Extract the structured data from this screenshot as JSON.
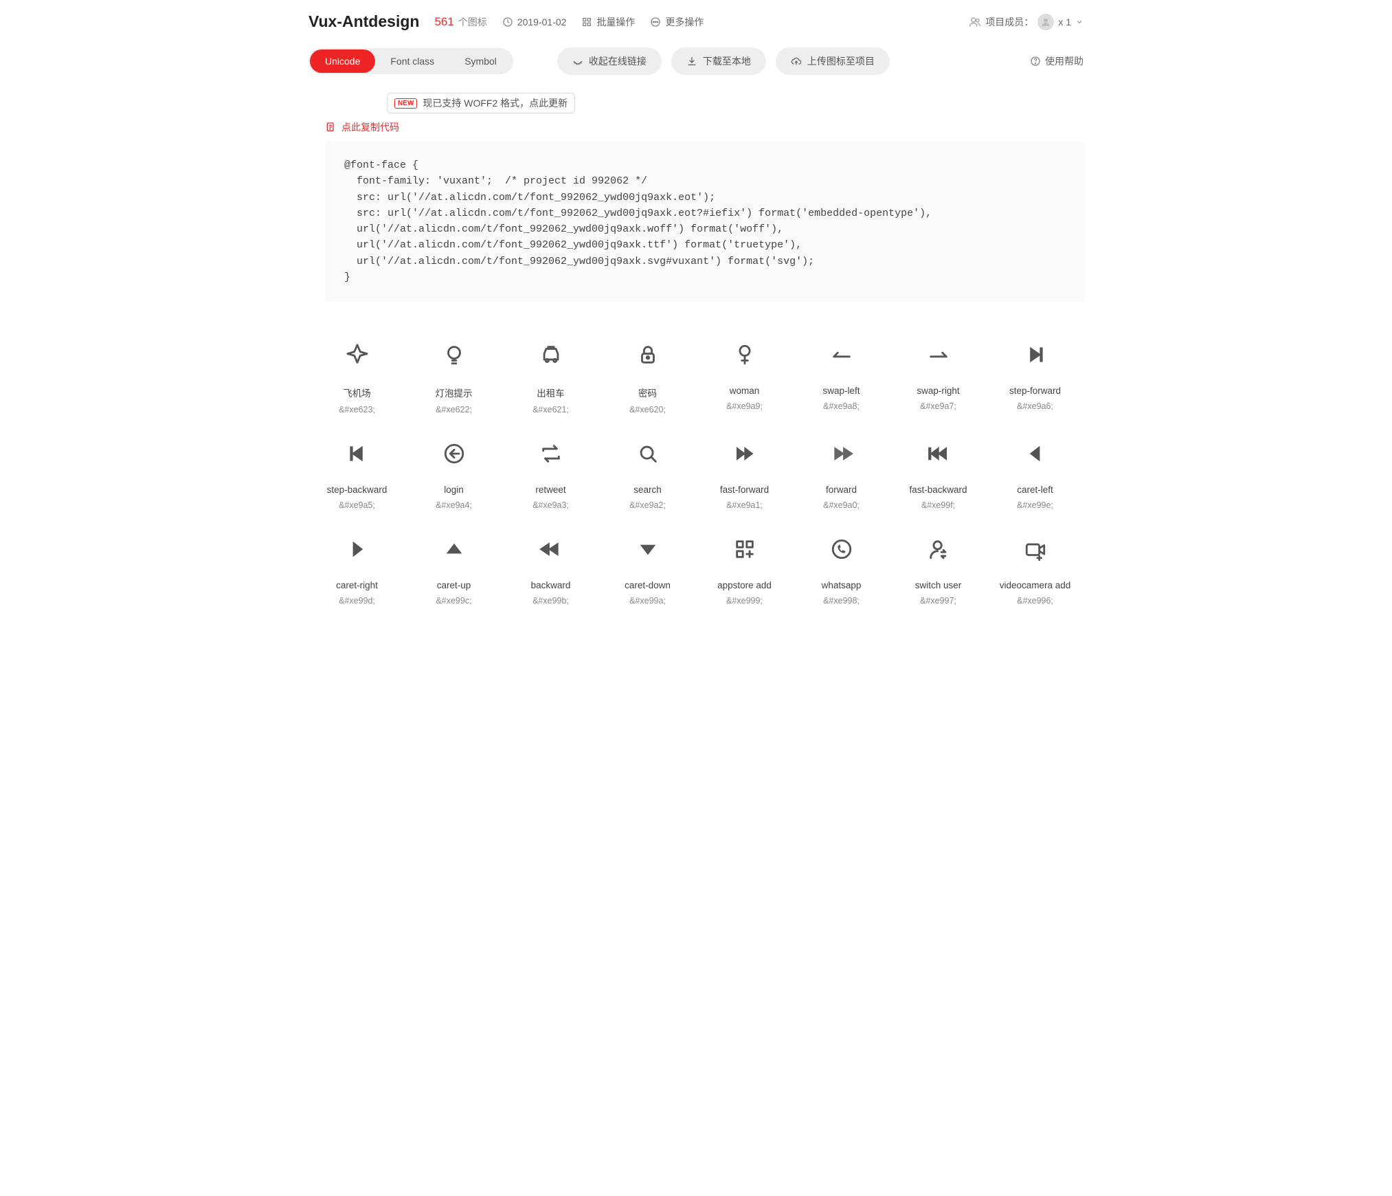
{
  "project": {
    "title": "Vux-Antdesign",
    "count": "561",
    "count_label": "个图标",
    "date": "2019-01-02",
    "batch_label": "批量操作",
    "more_label": "更多操作",
    "members_label": "项目成员：",
    "members_count": "x 1"
  },
  "tabs": {
    "unicode": "Unicode",
    "fontclass": "Font class",
    "symbol": "Symbol"
  },
  "actions": {
    "collapse": "收起在线链接",
    "download": "下载至本地",
    "upload": "上传图标至项目",
    "help": "使用帮助"
  },
  "notice": {
    "badge": "NEW",
    "text": "现已支持 WOFF2 格式，点此更新"
  },
  "copy_code": "点此复制代码",
  "code": "@font-face {\n  font-family: 'vuxant';  /* project id 992062 */\n  src: url('//at.alicdn.com/t/font_992062_ywd00jq9axk.eot');\n  src: url('//at.alicdn.com/t/font_992062_ywd00jq9axk.eot?#iefix') format('embedded-opentype'),\n  url('//at.alicdn.com/t/font_992062_ywd00jq9axk.woff') format('woff'),\n  url('//at.alicdn.com/t/font_992062_ywd00jq9axk.ttf') format('truetype'),\n  url('//at.alicdn.com/t/font_992062_ywd00jq9axk.svg#vuxant') format('svg');\n}",
  "icons": [
    {
      "glyph": "airplane",
      "name": "飞机场",
      "code": "&#xe623;"
    },
    {
      "glyph": "bulb",
      "name": "灯泡提示",
      "code": "&#xe622;"
    },
    {
      "glyph": "taxi",
      "name": "出租车",
      "code": "&#xe621;"
    },
    {
      "glyph": "lock",
      "name": "密码",
      "code": "&#xe620;"
    },
    {
      "glyph": "woman",
      "name": "woman",
      "code": "&#xe9a9;"
    },
    {
      "glyph": "swap-left",
      "name": "swap-left",
      "code": "&#xe9a8;"
    },
    {
      "glyph": "swap-right",
      "name": "swap-right",
      "code": "&#xe9a7;"
    },
    {
      "glyph": "step-forward",
      "name": "step-forward",
      "code": "&#xe9a6;"
    },
    {
      "glyph": "step-backward",
      "name": "step-backward",
      "code": "&#xe9a5;"
    },
    {
      "glyph": "login",
      "name": "login",
      "code": "&#xe9a4;"
    },
    {
      "glyph": "retweet",
      "name": "retweet",
      "code": "&#xe9a3;"
    },
    {
      "glyph": "search",
      "name": "search",
      "code": "&#xe9a2;"
    },
    {
      "glyph": "fast-forward",
      "name": "fast-forward",
      "code": "&#xe9a1;"
    },
    {
      "glyph": "forward",
      "name": "forward",
      "code": "&#xe9a0;"
    },
    {
      "glyph": "fast-backward",
      "name": "fast-backward",
      "code": "&#xe99f;"
    },
    {
      "glyph": "caret-left",
      "name": "caret-left",
      "code": "&#xe99e;"
    },
    {
      "glyph": "caret-right",
      "name": "caret-right",
      "code": "&#xe99d;"
    },
    {
      "glyph": "caret-up",
      "name": "caret-up",
      "code": "&#xe99c;"
    },
    {
      "glyph": "backward",
      "name": "backward",
      "code": "&#xe99b;"
    },
    {
      "glyph": "caret-down",
      "name": "caret-down",
      "code": "&#xe99a;"
    },
    {
      "glyph": "appstore-add",
      "name": "appstore add",
      "code": "&#xe999;"
    },
    {
      "glyph": "whatsapp",
      "name": "whatsapp",
      "code": "&#xe998;"
    },
    {
      "glyph": "switch-user",
      "name": "switch user",
      "code": "&#xe997;"
    },
    {
      "glyph": "videocamera-add",
      "name": "videocamera add",
      "code": "&#xe996;"
    }
  ]
}
